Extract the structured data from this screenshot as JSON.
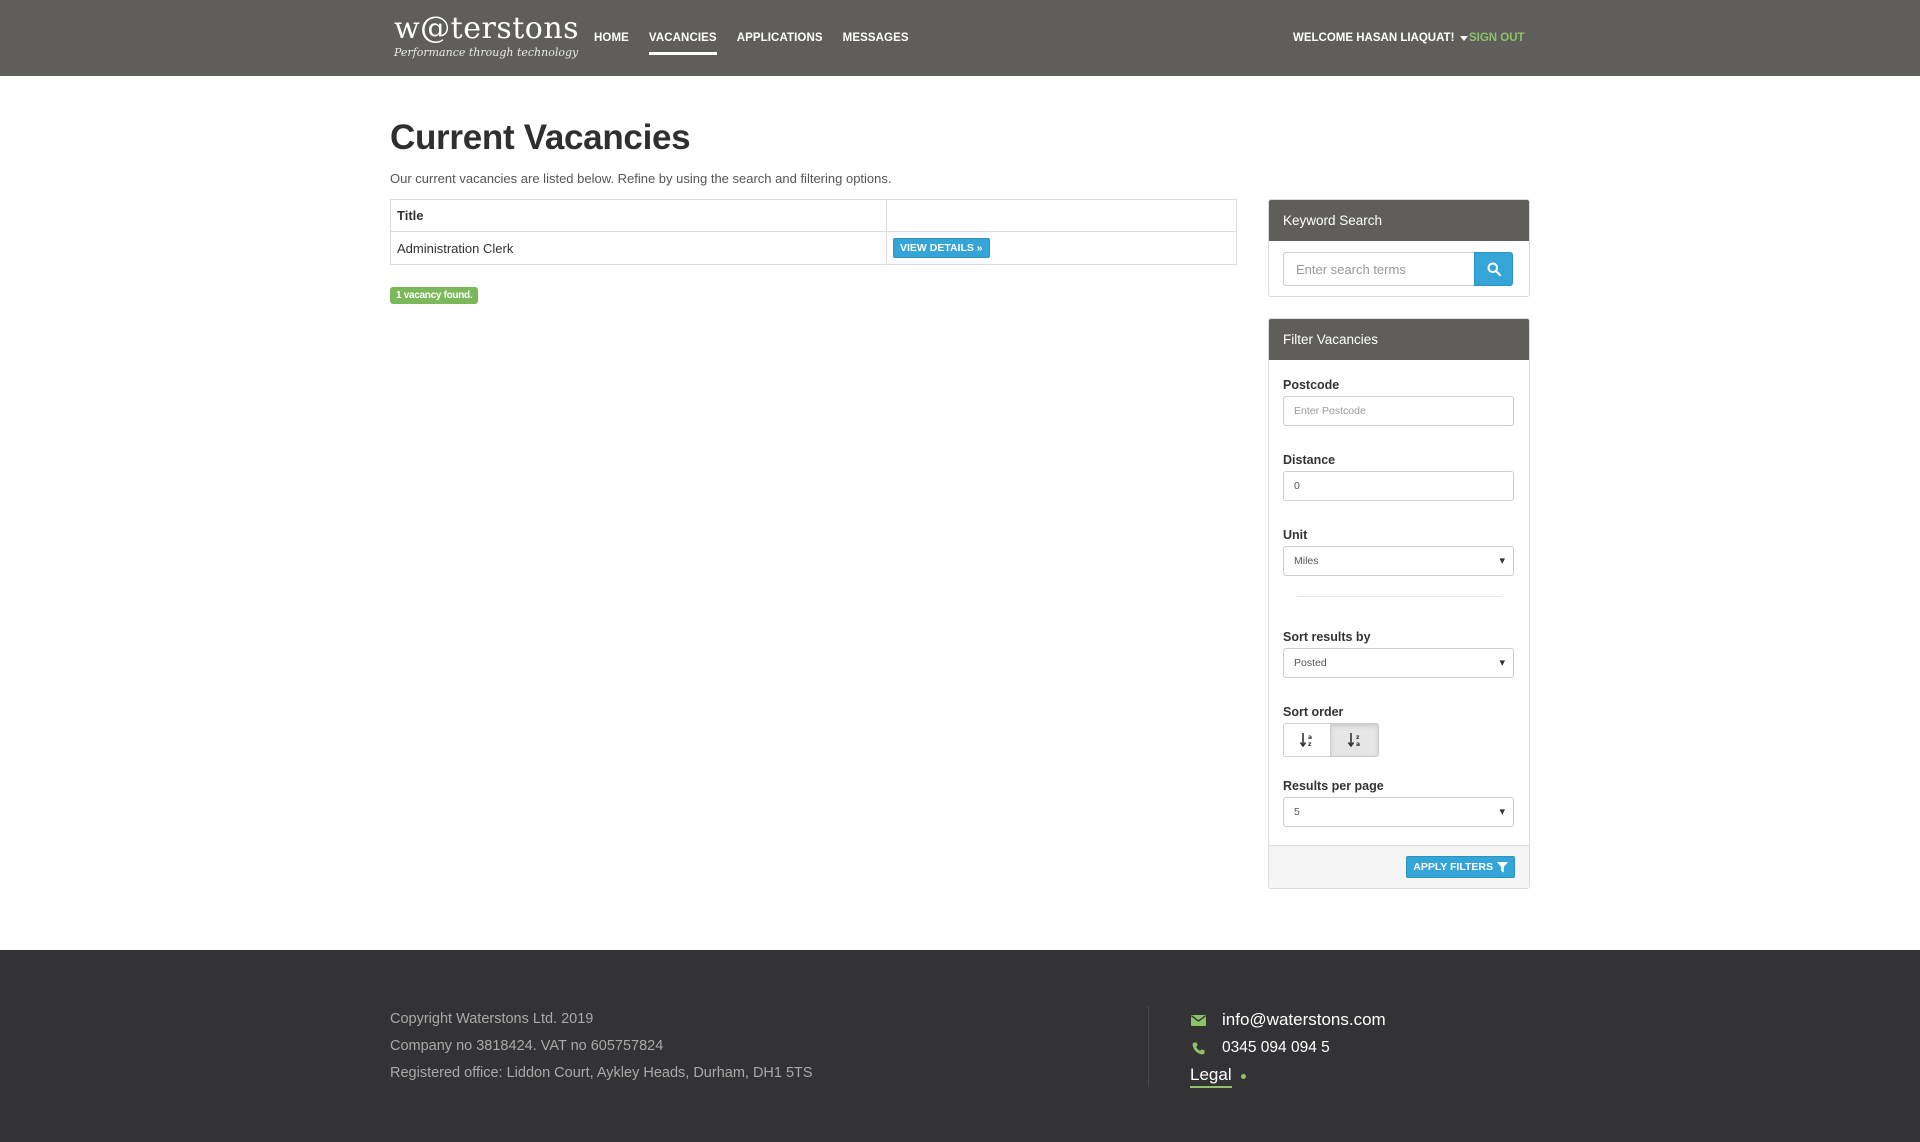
{
  "header": {
    "logo_text": "w@terstons",
    "logo_tagline": "Performance through technology",
    "nav": [
      {
        "label": "HOME",
        "active": false
      },
      {
        "label": "VACANCIES",
        "active": true
      },
      {
        "label": "APPLICATIONS",
        "active": false
      },
      {
        "label": "MESSAGES",
        "active": false
      }
    ],
    "welcome": "WELCOME HASAN LIAQUAT!",
    "signout": "SIGN OUT"
  },
  "main": {
    "title": "Current Vacancies",
    "intro": "Our current vacancies are listed below. Refine by using the search and filtering options.",
    "table": {
      "columns": [
        "Title",
        ""
      ],
      "rows": [
        {
          "title": "Administration Clerk",
          "action": "VIEW DETAILS »"
        }
      ]
    },
    "count_badge": "1 vacancy found."
  },
  "keyword_search": {
    "heading": "Keyword Search",
    "placeholder": "Enter search terms",
    "icon": "search-icon"
  },
  "filters": {
    "heading": "Filter Vacancies",
    "postcode": {
      "label": "Postcode",
      "placeholder": "Enter Postcode",
      "value": ""
    },
    "distance": {
      "label": "Distance",
      "value": "0"
    },
    "unit": {
      "label": "Unit",
      "value": "Miles"
    },
    "sort_by": {
      "label": "Sort results by",
      "value": "Posted"
    },
    "sort_order": {
      "label": "Sort order",
      "options": [
        "sort-ascending-icon",
        "sort-descending-icon"
      ],
      "selected": "sort-descending-icon"
    },
    "per_page": {
      "label": "Results per page",
      "value": "5"
    },
    "apply": "APPLY FILTERS"
  },
  "footer": {
    "copyright": "Copyright Waterstons Ltd. 2019",
    "company": "Company no 3818424. VAT no 605757824",
    "office": "Registered office: Liddon Court, Aykley Heads, Durham, DH1 5TS",
    "email": "info@waterstons.com",
    "phone": "0345 094 094 5",
    "legal": "Legal"
  },
  "colors": {
    "header_bg": "#5f5e5b",
    "accent_blue": "#35a4d6",
    "accent_green": "#8dc26b",
    "footer_bg": "#333335"
  }
}
